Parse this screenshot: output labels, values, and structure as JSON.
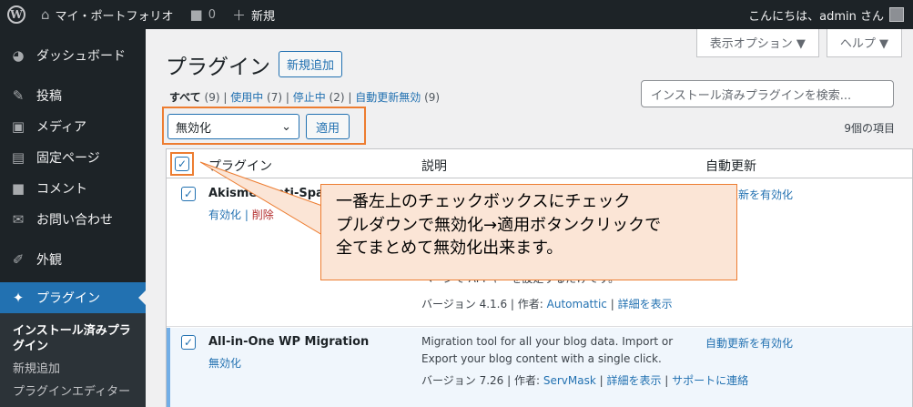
{
  "adminbar": {
    "site_name": "マイ・ポートフォリオ",
    "comment_count": "0",
    "new_label": "新規",
    "greeting": "こんにちは、admin さん"
  },
  "sidebar": {
    "items": [
      {
        "label": "ダッシュボード",
        "icon": "dashboard-icon"
      },
      {
        "label": "投稿",
        "icon": "pin-icon"
      },
      {
        "label": "メディア",
        "icon": "media-icon"
      },
      {
        "label": "固定ページ",
        "icon": "page-icon"
      },
      {
        "label": "コメント",
        "icon": "comment-icon"
      },
      {
        "label": "お問い合わせ",
        "icon": "mail-icon"
      },
      {
        "label": "外観",
        "icon": "brush-icon"
      },
      {
        "label": "プラグイン",
        "icon": "plugin-icon"
      }
    ],
    "submenu": [
      "インストール済みプラグイン",
      "新規追加",
      "プラグインエディター"
    ]
  },
  "screen_options": {
    "screen": "表示オプション ▼",
    "help": "ヘルプ ▼"
  },
  "page": {
    "title": "プラグイン",
    "add_new": "新規追加",
    "filters": {
      "all": "すべて",
      "all_count": "(9)",
      "active": "使用中",
      "active_count": "(7)",
      "inactive": "停止中",
      "inactive_count": "(2)",
      "autoupdate_off": "自動更新無効",
      "autoupdate_off_count": "(9)"
    },
    "search_placeholder": "インストール済みプラグインを検索...",
    "bulk_action": "無効化",
    "apply": "適用",
    "items_count": "9個の項目"
  },
  "table": {
    "columns": [
      "プラグイン",
      "説明",
      "自動更新"
    ],
    "rows": [
      {
        "name": "Akismet Anti-Spam",
        "action1": "有効化",
        "action2": "削除",
        "desc_line": "ページで API キーを設定するだけです。",
        "meta_prefix": "バージョン 4.1.6 | 作者: ",
        "author": "Automattic",
        "details": "詳細を表示",
        "autoupdate": "自動更新を有効化"
      },
      {
        "name": "All-in-One WP Migration",
        "action1": "無効化",
        "desc_line1": "Migration tool for all your blog data. Import or",
        "desc_line2": "Export your blog content with a single click.",
        "meta_prefix": "バージョン 7.26 | 作者: ",
        "author": "ServMask",
        "details": "詳細を表示",
        "support": "サポートに連絡",
        "autoupdate": "自動更新を有効化"
      }
    ]
  },
  "callout": {
    "line1": "一番左上のチェックボックスにチェック",
    "line2": "プルダウンで無効化→適用ボタンクリックで",
    "line3": "全てまとめて無効化出来ます。"
  },
  "colors": {
    "accent": "#2271b1",
    "highlight": "#ed7d31",
    "callout_bg": "#fbe5d6"
  }
}
